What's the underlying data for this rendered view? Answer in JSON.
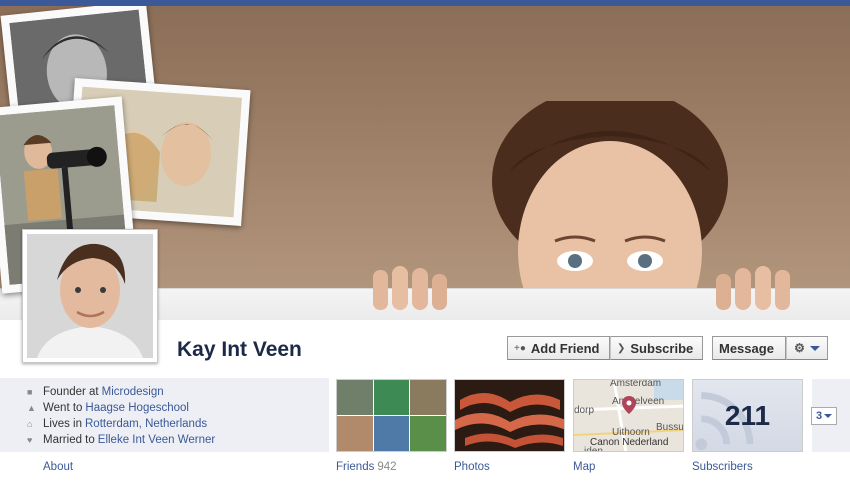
{
  "profile": {
    "name": "Kay Int Veen"
  },
  "actions": {
    "add_friend_label": "Add Friend",
    "subscribe_label": "Subscribe",
    "message_label": "Message"
  },
  "info": [
    {
      "prefix": "Founder at",
      "link": "Microdesign",
      "icon": "briefcase-icon"
    },
    {
      "prefix": "Went to",
      "link": "Haagse Hogeschool",
      "icon": "graduation-cap-icon"
    },
    {
      "prefix": "Lives in",
      "link": "Rotterdam, Netherlands",
      "icon": "house-icon"
    },
    {
      "prefix": "Married to",
      "link": "Elleke Int Veen Werner",
      "icon": "heart-icon"
    }
  ],
  "sections": {
    "about_label": "About",
    "friends_label": "Friends",
    "friends_count": "942",
    "photos_label": "Photos",
    "map_label": "Map",
    "subscribers_label": "Subscribers",
    "subscribers_count": "211",
    "more_count": "3"
  },
  "map": {
    "places": [
      "Amsterdam",
      "Amstelveen",
      "dorp",
      "Uithoorn",
      "Bussum",
      "Canon Nederland",
      "iden"
    ]
  },
  "colors": {
    "brand": "#3b5998",
    "name_color": "#1c2a47",
    "info_bg": "#edeff4"
  }
}
